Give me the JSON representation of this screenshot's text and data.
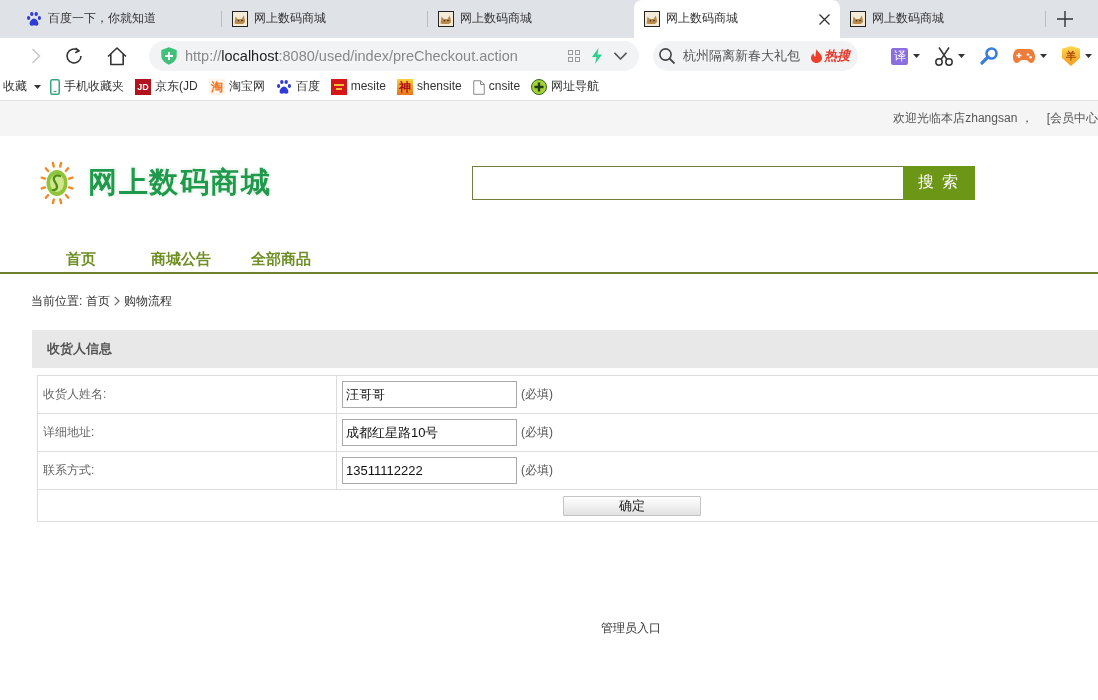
{
  "browser": {
    "tabs": [
      {
        "kind": "paw",
        "title": "百度一下，你就知道",
        "selected": false
      },
      {
        "kind": "cat",
        "title": "网上数码商城",
        "selected": false
      },
      {
        "kind": "cat",
        "title": "网上数码商城",
        "selected": false
      },
      {
        "kind": "cat",
        "title": "网上数码商城",
        "selected": true
      },
      {
        "kind": "cat",
        "title": "网上数码商城",
        "selected": false
      }
    ],
    "nav_buttons": [
      {
        "kind": "forward",
        "disabled": true
      },
      {
        "kind": "reload",
        "disabled": false
      },
      {
        "kind": "home",
        "disabled": false
      }
    ],
    "address": {
      "scheme": "http://",
      "host": "localhost",
      "path": ":8080/used/index/preCheckout.action"
    },
    "search": {
      "placeholder": "杭州隔离新春大礼包",
      "hot_label": "热搜"
    },
    "toolbar": [
      {
        "kind": "translate",
        "glyph": "译",
        "menu": true
      },
      {
        "kind": "scissors",
        "menu": true
      },
      {
        "kind": "magnifier",
        "menu": false
      },
      {
        "kind": "gamepad",
        "menu": true
      },
      {
        "kind": "shield",
        "glyph": "羊",
        "menu": true
      }
    ],
    "bookmarks": {
      "menu_label": "收藏",
      "items": [
        {
          "kind": "phone",
          "label": "手机收藏夹"
        },
        {
          "kind": "lettertile",
          "glyph": "JD",
          "label": "京东(JD"
        },
        {
          "kind": "glyph",
          "glyph": "淘",
          "label": "淘宝网"
        },
        {
          "kind": "paw",
          "label": "百度"
        },
        {
          "kind": "tile",
          "label": "mesite"
        },
        {
          "kind": "glyphtile",
          "glyph": "神",
          "label": "shensite"
        },
        {
          "kind": "page",
          "label": "cnsite"
        },
        {
          "kind": "pluscircle",
          "label": "网址导航"
        }
      ]
    }
  },
  "top_bar": {
    "welcome": "欢迎光临本店zhangsan ，",
    "member_link": "[会员中心"
  },
  "header": {
    "logo": "网上数码商城",
    "search_button": "搜 索"
  },
  "nav": [
    {
      "label": "首页"
    },
    {
      "label": "商城公告"
    },
    {
      "label": "全部商品"
    }
  ],
  "breadcrumb": {
    "label": "当前位置:",
    "items": [
      "首页",
      "购物流程"
    ]
  },
  "consignee": {
    "title": "收货人信息",
    "fields": [
      {
        "label": "收货人姓名:",
        "value": "汪哥哥",
        "note": "(必填)"
      },
      {
        "label": "详细地址:",
        "value": "成都红星路10号",
        "note": "(必填)"
      },
      {
        "label": "联系方式:",
        "value": "13511112222",
        "note": "(必填)"
      }
    ],
    "submit": "确定"
  },
  "footer": {
    "admin_link": "管理员入口"
  }
}
